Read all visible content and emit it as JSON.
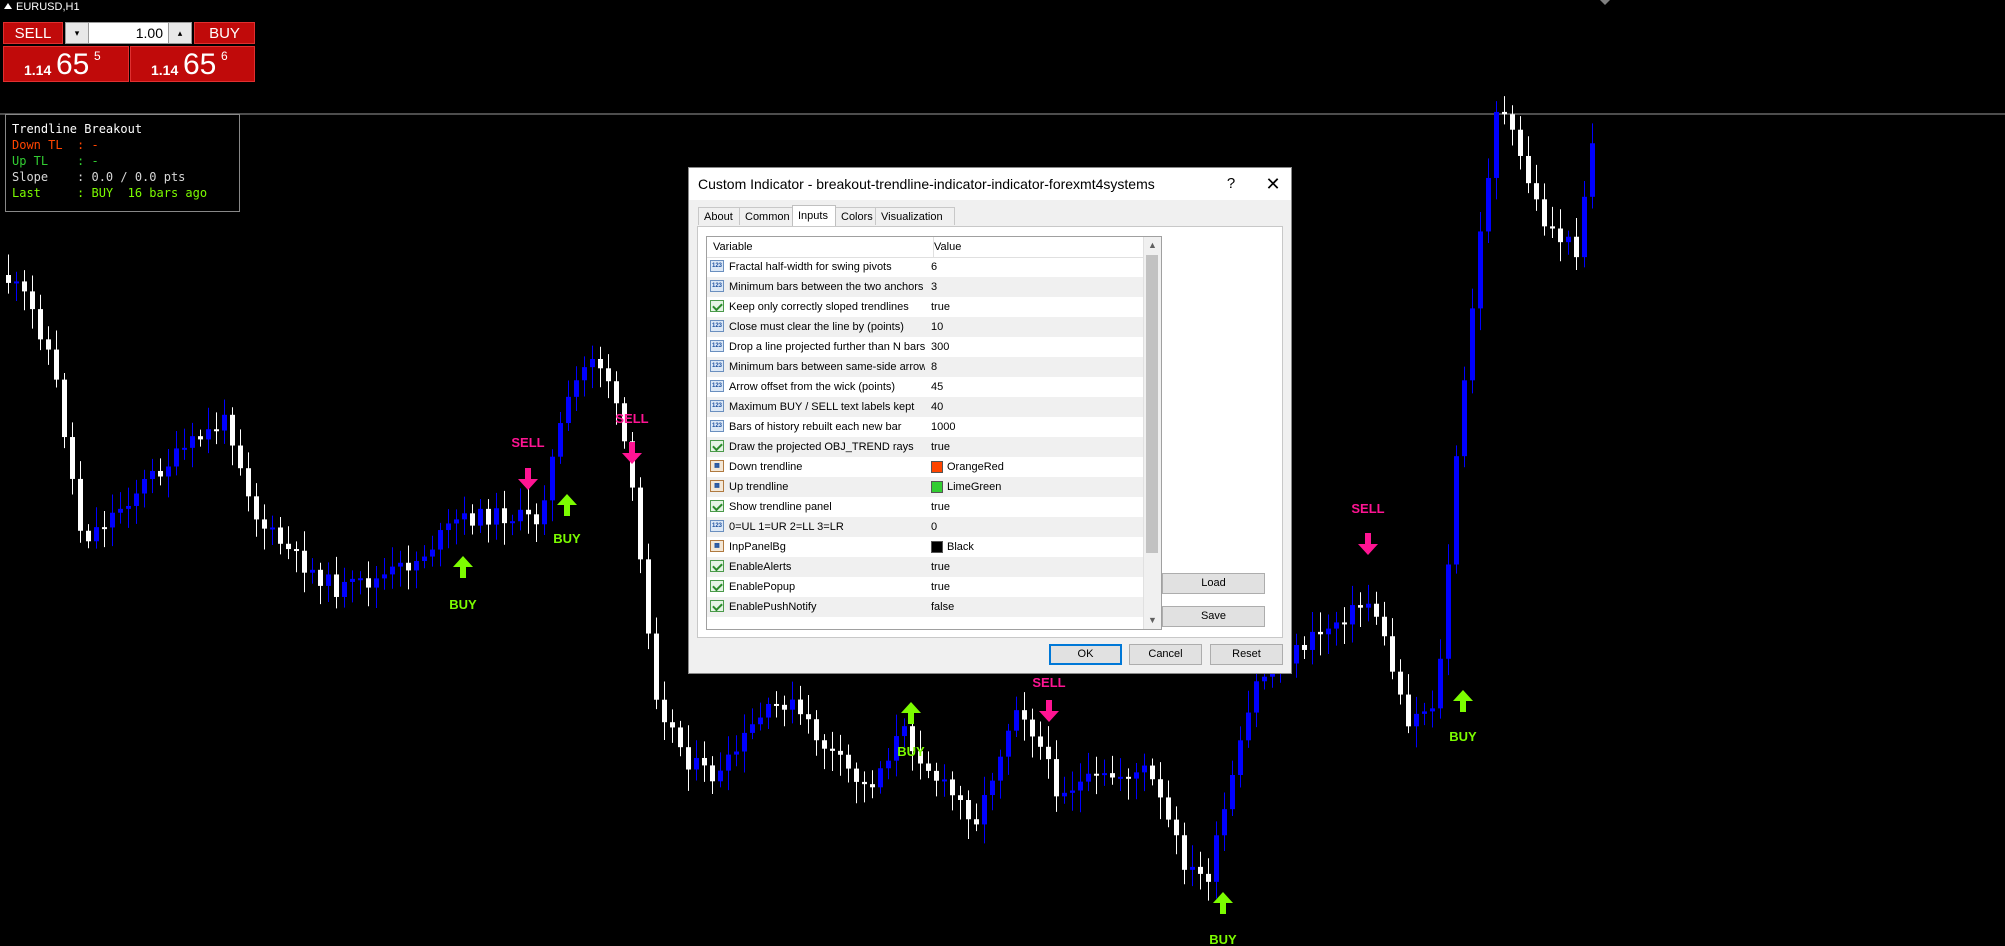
{
  "window": {
    "symbol": "EURUSD,H1"
  },
  "trading": {
    "sell_label": "SELL",
    "buy_label": "BUY",
    "lot": "1.00",
    "lot_down": "▾",
    "lot_up": "▴",
    "bid": {
      "big": "1.14",
      "pips": "65",
      "frac": "5"
    },
    "ask": {
      "big": "1.14",
      "pips": "65",
      "frac": "6"
    }
  },
  "panel": {
    "title": "Trendline Breakout",
    "down": "Down TL  : -",
    "up": "Up TL    : -",
    "slope": "Slope    : 0.0 / 0.0 pts",
    "last": "Last     : BUY  16 bars ago"
  },
  "colors": {
    "bull": "#0000ff",
    "bear": "#ffffff",
    "buy": "#7cfc00",
    "sell": "#ff1493",
    "down_tl": "#ff4500",
    "up_tl": "#32cd32",
    "panel_bg": "#000000"
  },
  "chart": {
    "signals": [
      {
        "type": "SELL",
        "label": "SELL"
      },
      {
        "type": "SELL",
        "label": "SELL"
      },
      {
        "type": "BUY",
        "label": "BUY"
      },
      {
        "type": "BUY",
        "label": "BUY"
      },
      {
        "type": "SELL",
        "label": "SELL"
      },
      {
        "type": "BUY",
        "label": "BUY"
      },
      {
        "type": "SELL",
        "label": "SELL"
      },
      {
        "type": "BUY",
        "label": "BUY"
      },
      {
        "type": "BUY",
        "label": "BUY"
      }
    ]
  },
  "dialog": {
    "title": "Custom Indicator - breakout-trendline-indicator-indicator-forexmt4systems",
    "help": "?",
    "close": "✕",
    "tabs": [
      "About",
      "Common",
      "Inputs",
      "Colors",
      "Visualization"
    ],
    "active_tab": "Inputs",
    "columns": {
      "variable": "Variable",
      "value": "Value"
    },
    "rows": [
      {
        "icon": "int",
        "name": "Fractal half-width for swing pivots",
        "value": "6"
      },
      {
        "icon": "int",
        "name": "Minimum bars between the two anchors",
        "value": "3"
      },
      {
        "icon": "bool",
        "name": "Keep only correctly sloped trendlines",
        "value": "true"
      },
      {
        "icon": "int",
        "name": "Close must clear the line by (points)",
        "value": "10"
      },
      {
        "icon": "int",
        "name": "Drop a line projected further than N bars",
        "value": "300"
      },
      {
        "icon": "int",
        "name": "Minimum bars between same-side arrows",
        "value": "8"
      },
      {
        "icon": "int",
        "name": "Arrow offset from the wick (points)",
        "value": "45"
      },
      {
        "icon": "int",
        "name": "Maximum BUY / SELL text labels kept",
        "value": "40"
      },
      {
        "icon": "int",
        "name": "Bars of history rebuilt each new bar",
        "value": "1000"
      },
      {
        "icon": "bool",
        "name": "Draw the projected OBJ_TREND rays",
        "value": "true"
      },
      {
        "icon": "color",
        "name": "Down trendline",
        "value": "OrangeRed",
        "swatch": "#ff4500"
      },
      {
        "icon": "color",
        "name": "Up trendline",
        "value": "LimeGreen",
        "swatch": "#32cd32"
      },
      {
        "icon": "bool",
        "name": "Show trendline panel",
        "value": "true"
      },
      {
        "icon": "int",
        "name": "0=UL 1=UR 2=LL 3=LR",
        "value": "0"
      },
      {
        "icon": "color",
        "name": "InpPanelBg",
        "value": "Black",
        "swatch": "#000000"
      },
      {
        "icon": "bool",
        "name": "EnableAlerts",
        "value": "true"
      },
      {
        "icon": "bool",
        "name": "EnablePopup",
        "value": "true"
      },
      {
        "icon": "bool",
        "name": "EnablePushNotify",
        "value": "false"
      }
    ],
    "buttons": {
      "load": "Load",
      "save": "Save",
      "ok": "OK",
      "cancel": "Cancel",
      "reset": "Reset"
    }
  }
}
